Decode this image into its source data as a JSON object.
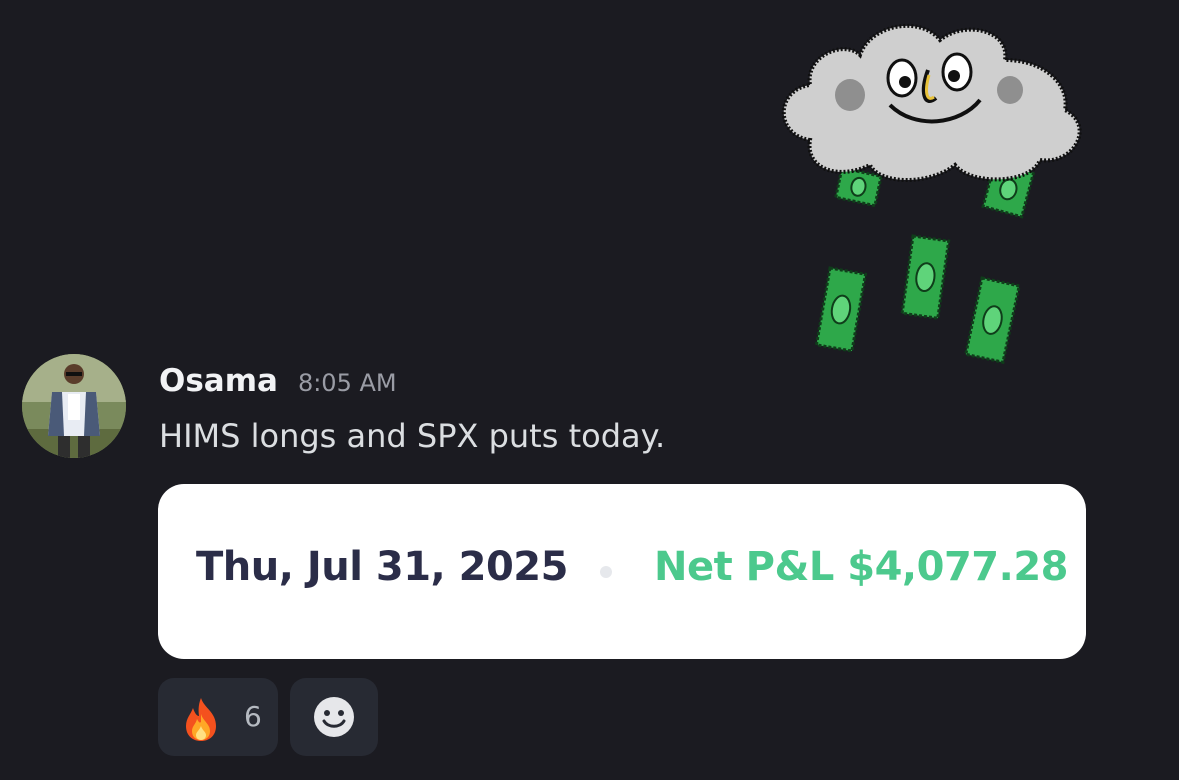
{
  "message": {
    "author": "Osama",
    "timestamp": "8:05 AM",
    "text": "HIMS longs and SPX puts today.",
    "avatar_icon": "user-avatar-photo",
    "sticker_icon": "cloud-raining-money-sticker"
  },
  "embed": {
    "date": "Thu, Jul 31, 2025",
    "pnl_label": "Net P&L $4,077.28",
    "pnl_color": "#4cc98d",
    "date_color": "#2b2d48"
  },
  "reactions": [
    {
      "emoji_icon": "fire-icon",
      "count": "6"
    },
    {
      "emoji_icon": "add-reaction-smile-icon"
    }
  ],
  "colors": {
    "background": "#1b1b21",
    "reaction_bg": "#272a33"
  }
}
